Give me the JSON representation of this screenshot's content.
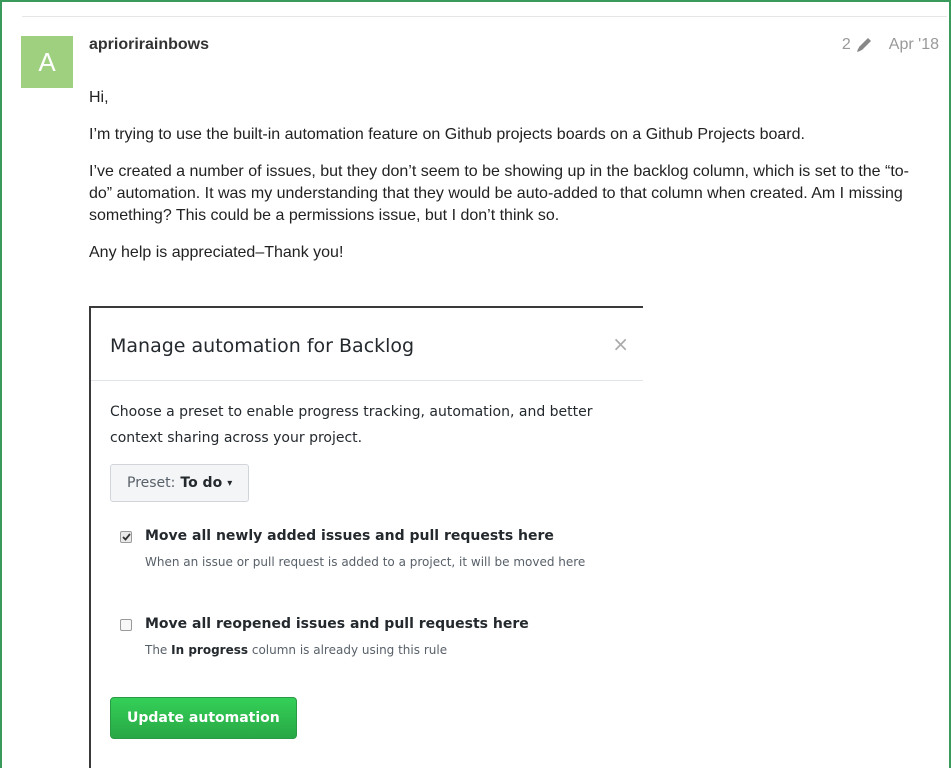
{
  "post": {
    "avatar_letter": "A",
    "username": "apriorirainbows",
    "edit_count": "2",
    "date": "Apr '18",
    "paragraphs": [
      "Hi,",
      "I’m trying to use the built-in automation feature on Github projects boards on a Github Projects board.",
      "I’ve created a number of issues, but they don’t seem to be showing up in the backlog column, which is set to the “to-do” automation. It was my understanding that they would be auto-added to that column when created. Am I missing something? This could be a permissions issue, but I don’t think so.",
      "Any help is appreciated–Thank you!"
    ]
  },
  "modal": {
    "title": "Manage automation for Backlog",
    "close_glyph": "×",
    "description": "Choose a preset to enable progress tracking, automation, and better context sharing across your project.",
    "preset": {
      "label": "Preset:",
      "value": "To do",
      "caret": "▾"
    },
    "options": [
      {
        "checked": true,
        "title": "Move all newly added issues and pull requests here",
        "description": "When an issue or pull request is added to a project, it will be moved here"
      },
      {
        "checked": false,
        "title": "Move all reopened issues and pull requests here",
        "desc_prefix": "The",
        "desc_bold": "In progress",
        "desc_suffix": "column is already using this rule"
      }
    ],
    "submit_label": "Update automation"
  },
  "colors": {
    "frame_border": "#3a9a5b",
    "avatar_bg": "#9fd07f",
    "primary_button": "#28a745"
  }
}
